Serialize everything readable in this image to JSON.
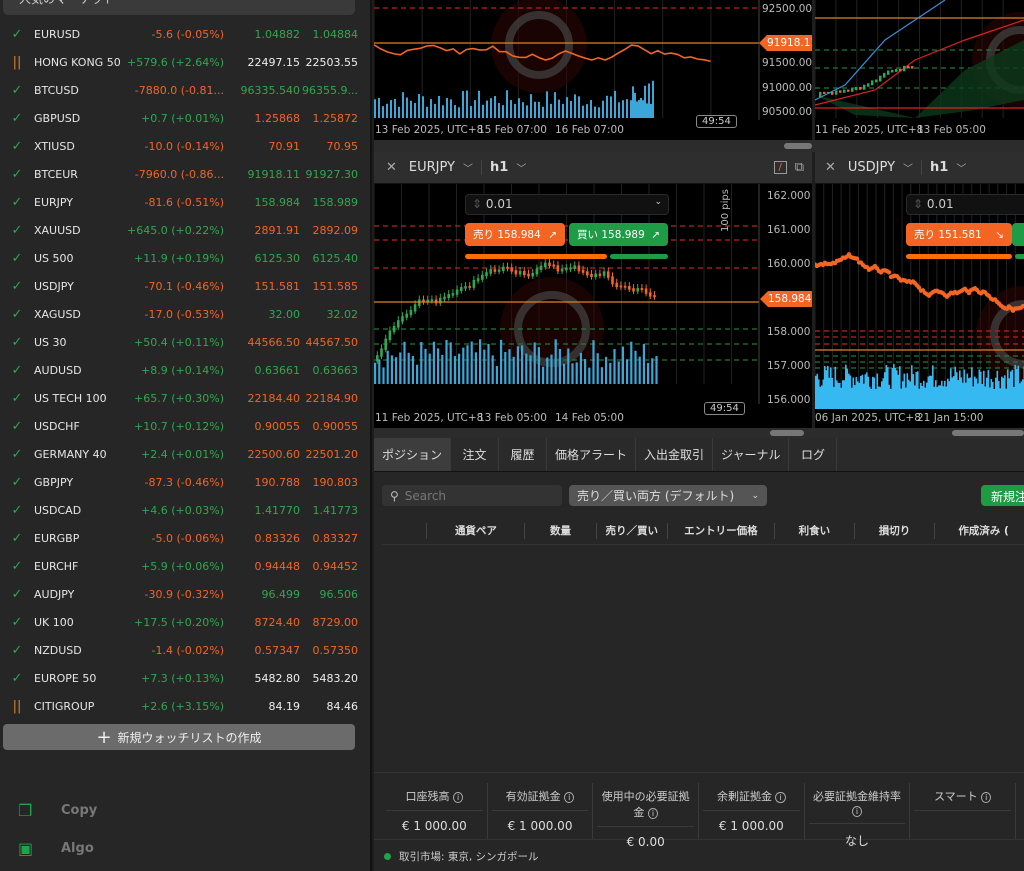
{
  "sidebar": {
    "header": "人気のマーケット",
    "rows": [
      {
        "name": "EURUSD",
        "change": "-5.6 (-0.05%)",
        "bid": "1.04882",
        "ask": "1.04884",
        "status": "check",
        "c": "dn",
        "bc": "up",
        "ac": "up"
      },
      {
        "name": "HONG KONG 50",
        "change": "+579.6 (+2.64%)",
        "bid": "22497.15",
        "ask": "22503.55",
        "status": "pause",
        "c": "up",
        "bc": "nt",
        "ac": "nt"
      },
      {
        "name": "BTCUSD",
        "change": "-7880.0 (-0.81...",
        "bid": "96335.540",
        "ask": "96355.9...",
        "status": "check",
        "c": "dn",
        "bc": "up",
        "ac": "up"
      },
      {
        "name": "GBPUSD",
        "change": "+0.7 (+0.01%)",
        "bid": "1.25868",
        "ask": "1.25872",
        "status": "check",
        "c": "up",
        "bc": "dn",
        "ac": "dn"
      },
      {
        "name": "XTIUSD",
        "change": "-10.0 (-0.14%)",
        "bid": "70.91",
        "ask": "70.95",
        "status": "check",
        "c": "dn",
        "bc": "dn",
        "ac": "dn"
      },
      {
        "name": "BTCEUR",
        "change": "-7960.0 (-0.86...",
        "bid": "91918.11",
        "ask": "91927.30",
        "status": "check",
        "c": "dn",
        "bc": "up",
        "ac": "up"
      },
      {
        "name": "EURJPY",
        "change": "-81.6 (-0.51%)",
        "bid": "158.984",
        "ask": "158.989",
        "status": "check",
        "c": "dn",
        "bc": "up",
        "ac": "up"
      },
      {
        "name": "XAUUSD",
        "change": "+645.0 (+0.22%)",
        "bid": "2891.91",
        "ask": "2892.09",
        "status": "check",
        "c": "up",
        "bc": "dn",
        "ac": "dn"
      },
      {
        "name": "US 500",
        "change": "+11.9 (+0.19%)",
        "bid": "6125.30",
        "ask": "6125.40",
        "status": "check",
        "c": "up",
        "bc": "up",
        "ac": "up"
      },
      {
        "name": "USDJPY",
        "change": "-70.1 (-0.46%)",
        "bid": "151.581",
        "ask": "151.585",
        "status": "check",
        "c": "dn",
        "bc": "dn",
        "ac": "dn"
      },
      {
        "name": "XAGUSD",
        "change": "-17.0 (-0.53%)",
        "bid": "32.00",
        "ask": "32.02",
        "status": "check",
        "c": "dn",
        "bc": "up",
        "ac": "up"
      },
      {
        "name": "US 30",
        "change": "+50.4 (+0.11%)",
        "bid": "44566.50",
        "ask": "44567.50",
        "status": "check",
        "c": "up",
        "bc": "dn",
        "ac": "dn"
      },
      {
        "name": "AUDUSD",
        "change": "+8.9 (+0.14%)",
        "bid": "0.63661",
        "ask": "0.63663",
        "status": "check",
        "c": "up",
        "bc": "up",
        "ac": "up"
      },
      {
        "name": "US TECH 100",
        "change": "+65.7 (+0.30%)",
        "bid": "22184.40",
        "ask": "22184.90",
        "status": "check",
        "c": "up",
        "bc": "dn",
        "ac": "dn"
      },
      {
        "name": "USDCHF",
        "change": "+10.7 (+0.12%)",
        "bid": "0.90055",
        "ask": "0.90055",
        "status": "check",
        "c": "up",
        "bc": "dn",
        "ac": "dn"
      },
      {
        "name": "GERMANY 40",
        "change": "+2.4 (+0.01%)",
        "bid": "22500.60",
        "ask": "22501.20",
        "status": "check",
        "c": "up",
        "bc": "dn",
        "ac": "dn"
      },
      {
        "name": "GBPJPY",
        "change": "-87.3 (-0.46%)",
        "bid": "190.788",
        "ask": "190.803",
        "status": "check",
        "c": "dn",
        "bc": "dn",
        "ac": "dn"
      },
      {
        "name": "USDCAD",
        "change": "+4.6 (+0.03%)",
        "bid": "1.41770",
        "ask": "1.41773",
        "status": "check",
        "c": "up",
        "bc": "up",
        "ac": "up"
      },
      {
        "name": "EURGBP",
        "change": "-5.0 (-0.06%)",
        "bid": "0.83326",
        "ask": "0.83327",
        "status": "check",
        "c": "dn",
        "bc": "dn",
        "ac": "dn"
      },
      {
        "name": "EURCHF",
        "change": "+5.9 (+0.06%)",
        "bid": "0.94448",
        "ask": "0.94452",
        "status": "check",
        "c": "up",
        "bc": "dn",
        "ac": "dn"
      },
      {
        "name": "AUDJPY",
        "change": "-30.9 (-0.32%)",
        "bid": "96.499",
        "ask": "96.506",
        "status": "check",
        "c": "dn",
        "bc": "up",
        "ac": "up"
      },
      {
        "name": "UK 100",
        "change": "+17.5 (+0.20%)",
        "bid": "8724.40",
        "ask": "8729.00",
        "status": "check",
        "c": "up",
        "bc": "dn",
        "ac": "dn"
      },
      {
        "name": "NZDUSD",
        "change": "-1.4 (-0.02%)",
        "bid": "0.57347",
        "ask": "0.57350",
        "status": "check",
        "c": "dn",
        "bc": "dn",
        "ac": "dn"
      },
      {
        "name": "EUROPE 50",
        "change": "+7.3 (+0.13%)",
        "bid": "5482.80",
        "ask": "5483.20",
        "status": "check",
        "c": "up",
        "bc": "nt",
        "ac": "nt"
      },
      {
        "name": "CITIGROUP",
        "change": "+2.6 (+3.15%)",
        "bid": "84.19",
        "ask": "84.46",
        "status": "pause",
        "c": "up",
        "bc": "nt",
        "ac": "nt"
      }
    ],
    "new_watchlist": "新規ウォッチリストの作成",
    "nav": [
      {
        "label": "Copy",
        "icon": "copy-icon"
      },
      {
        "label": "Algo",
        "icon": "robot-icon"
      }
    ]
  },
  "charts": {
    "top_left": {
      "prices": [
        "92500.00",
        "91500.00",
        "91000.00",
        "90500.00"
      ],
      "current": "91918.11",
      "dates": [
        "13 Feb 2025, UTC+8",
        "15 Feb 07:00",
        "16 Feb 07:00"
      ],
      "timer": "49:54"
    },
    "top_right": {
      "dates": [
        "11 Feb 2025, UTC+8",
        "13 Feb 05:00"
      ]
    },
    "eurjpy": {
      "symbol": "EURJPY",
      "timeframe": "h1",
      "quantity": "0.01",
      "sell": "売り 158.984",
      "buy": "買い 158.989",
      "prices": [
        "162.000",
        "161.000",
        "160.000",
        "158.000",
        "157.000",
        "156.000"
      ],
      "current": "158.984",
      "pips": "100 pips",
      "dates": [
        "11 Feb 2025, UTC+8",
        "13 Feb 05:00",
        "14 Feb 05:00"
      ],
      "timer": "49:54"
    },
    "usdjpy": {
      "symbol": "USDJPY",
      "timeframe": "h1",
      "quantity": "0.01",
      "sell": "売り 151.581",
      "dates": [
        "06 Jan 2025, UTC+8",
        "21 Jan 15:00"
      ]
    },
    "colors": {
      "up": "#2fa84f",
      "down": "#f26522",
      "volume": "#3aa7d8"
    }
  },
  "bottom": {
    "tabs": [
      "ポジション",
      "注文",
      "履歴",
      "価格アラート",
      "入出金取引",
      "ジャーナル",
      "ログ"
    ],
    "search_placeholder": "Search",
    "filter": "売り／買い両方 (デフォルト)",
    "new_order": "新規注文",
    "columns": [
      "通貨ペア",
      "数量",
      "売り／買い",
      "エントリー価格",
      "利食い",
      "損切り",
      "作成済み ("
    ],
    "stats": [
      {
        "label": "口座残高",
        "value": "€ 1 000.00"
      },
      {
        "label": "有効証拠金",
        "value": "€ 1 000.00"
      },
      {
        "label": "使用中の必要証拠金",
        "value": "€ 0.00"
      },
      {
        "label": "余剰証拠金",
        "value": "€ 1 000.00"
      },
      {
        "label": "必要証拠金維持率",
        "value": "なし"
      },
      {
        "label": "スマート",
        "value": ""
      }
    ],
    "status": "取引市場: 東京, シンガポール"
  }
}
